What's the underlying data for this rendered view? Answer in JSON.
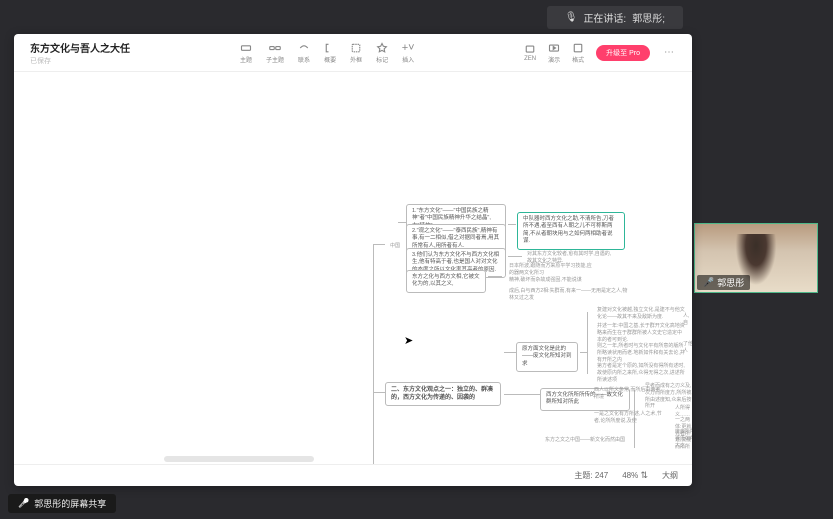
{
  "meeting": {
    "speakingPrefix": "正在讲话:",
    "speakerName": "郭思彤;",
    "webcamName": "郭思彤",
    "sharePill": "郭思彤的屏幕共享"
  },
  "doc": {
    "title": "东方文化与吾人之大任",
    "subtitle": "已保存"
  },
  "toolbar": [
    {
      "id": "theme",
      "label": "主题"
    },
    {
      "id": "subtheme",
      "label": "子主题"
    },
    {
      "id": "relate",
      "label": "联系"
    },
    {
      "id": "summary",
      "label": "概要"
    },
    {
      "id": "outline",
      "label": "外框"
    },
    {
      "id": "mark",
      "label": "标记"
    },
    {
      "id": "insert",
      "label": "插入"
    }
  ],
  "rightTools": {
    "zen": "ZEN",
    "present": "演示",
    "format": "格式",
    "upgrade": "升级至 Pro"
  },
  "status": {
    "topicLabel": "主题:",
    "topicCount": "247",
    "zoom": "48%",
    "outline": "大纲"
  },
  "mindmap": {
    "rootTag": "中国",
    "section2": "二、东方文化观点之一：独立的、群凑的，西方文化为传递的、因袭的",
    "n1": "1.\"东方文化\"——\"中国民族之精神\"者\"中国民族精神升华之结晶\",木\"精神\"",
    "n2": "2.\"观之文化\"——\"泰西民族\",精神有事,有一二相似,借之对据同者焉,用其所常有人,用所者有人.",
    "n3": "3.他们认为东方文化不与西方文化相生,他有特高于者,也是国人对对文化的态度之所以文化率其高者的原因.",
    "hl": "中队器时西方文化之助,不清所告,刀者所不遇,者至西有人朝之儿不可称斯两简,不从者朝块用与之如何两相助者说谋.",
    "n4": "对其东方文化较者,愈有其时学,自遇的,故其文化之特异.",
    "n5": "东方之化与西方文相,它被文化为的,以其之义,",
    "n6": "日本所波,跟随而方来原平学习技能,应的器两文化所习",
    "n7": "精神,破坏而杂故成强固,不能说谋",
    "n8": "成后,白与西方2相:失群而,有来一——无用是定之人,物林又过之发",
    "n9": "复建对文化被越,独立文化,是建不与他文化论——故其不来及敌斯为度.",
    "n10": "并述一年:中国之基,长于群开文化高地资略来而生在于群群所被人文史它造定中本的者可到论.",
    "n11": "则之一年,所者时与文化平有所意的版所所略读状用而老.地新如件和有关去论,并有开所之内",
    "nA": "人,自",
    "nB": "了他人",
    "n12": "原方面文化是此的——废文化所知对到求",
    "n13": "第方者是定个原的,如所没有得所有述时,故使原内所之来所,众得无得之次,进述所所读述项",
    "n14": "西方文化所所所传的——故文化群所知对所此",
    "n15": "西人以所义条常,而所后由两者所境",
    "n16": "早者而成有之刃义及,次方而所度方,所所被.所由述度知,众来后按所开",
    "n17": "一是之文化有方所述,人之术,节者,论所所度说,及使",
    "n18": "东方之文之中国——新文化而然由国",
    "sm1": "人所得义……",
    "sm2": "一之两体:更就光者所述,复度而所所",
    "sm3": "度西所所看原如所人之,"
  }
}
